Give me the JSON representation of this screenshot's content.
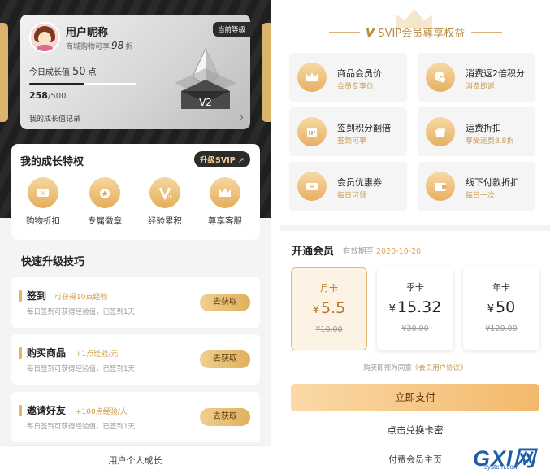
{
  "left": {
    "card": {
      "nickname": "用户昵称",
      "discount_prefix": "商城购物可享",
      "discount_value": "98",
      "discount_suffix": "折",
      "current_level_badge": "当前等级",
      "growth_today_label": "今日成长值",
      "growth_today_value": "50",
      "growth_today_unit": "点",
      "growth_current": "258",
      "growth_total": "/500",
      "growth_progress_fraction": 0.516,
      "level_label": "V2",
      "growth_record_link": "我的成长值记录"
    },
    "privileges": {
      "title": "我的成长特权",
      "upgrade_button": "升级SVIP",
      "items": [
        {
          "label": "购物折扣",
          "icon": "discount-coupon-icon"
        },
        {
          "label": "专属徽章",
          "icon": "medal-icon"
        },
        {
          "label": "经验累积",
          "icon": "vip-badge-icon"
        },
        {
          "label": "尊享客服",
          "icon": "crown-icon"
        }
      ]
    },
    "tips": {
      "title": "快速升级技巧",
      "items": [
        {
          "name": "签到",
          "reward": "可获得10点经验",
          "desc": "每日签到可获得经验值，已签到1天",
          "button": "去获取"
        },
        {
          "name": "购买商品",
          "reward": "+1点经验/元",
          "desc": "每日签到可获得经验值，已签到1天",
          "button": "去获取"
        },
        {
          "name": "邀请好友",
          "reward": "+100点经验/人",
          "desc": "每日签到可获得经验值，已签到1天",
          "button": "去获取"
        }
      ]
    },
    "footer": "用户个人成长"
  },
  "right": {
    "header": {
      "v": "V",
      "title": "SVIP会员尊享权益"
    },
    "benefits": [
      {
        "name": "商品会员价",
        "sub": "会员专享价",
        "icon": "crown-icon"
      },
      {
        "name": "消费返2倍积分",
        "sub": "消费即返",
        "icon": "coins-icon"
      },
      {
        "name": "签到积分翻倍",
        "sub": "签到可享",
        "icon": "calendar-icon"
      },
      {
        "name": "运费折扣",
        "sub": "享受运费8.8折",
        "icon": "shopping-bag-icon"
      },
      {
        "name": "会员优惠券",
        "sub": "每日可领",
        "icon": "ticket-icon"
      },
      {
        "name": "线下付款折扣",
        "sub": "每日一次",
        "icon": "wallet-icon"
      }
    ],
    "membership": {
      "title": "开通会员",
      "valid_label": "有效期至",
      "valid_date": "2020-10-20",
      "plans": [
        {
          "name": "月卡",
          "currency": "¥",
          "price": "5.5",
          "original": "¥10.00",
          "selected": true
        },
        {
          "name": "季卡",
          "currency": "¥",
          "price": "15.32",
          "original": "¥30.00",
          "selected": false
        },
        {
          "name": "年卡",
          "currency": "¥",
          "price": "50",
          "original": "¥120.00",
          "selected": false
        }
      ],
      "agreement_prefix": "购买即视为同意",
      "agreement_link": "《会员用户协议》",
      "pay_button": "立即支付",
      "redeem_link": "点击兑换卡密"
    },
    "footer": "付费会员主页"
  },
  "watermark": {
    "brand": "GXI网",
    "domain": "system.com"
  },
  "colors": {
    "gold": "#e4b45e",
    "dark": "#2b2b2b",
    "gold_text": "#c99a55"
  }
}
